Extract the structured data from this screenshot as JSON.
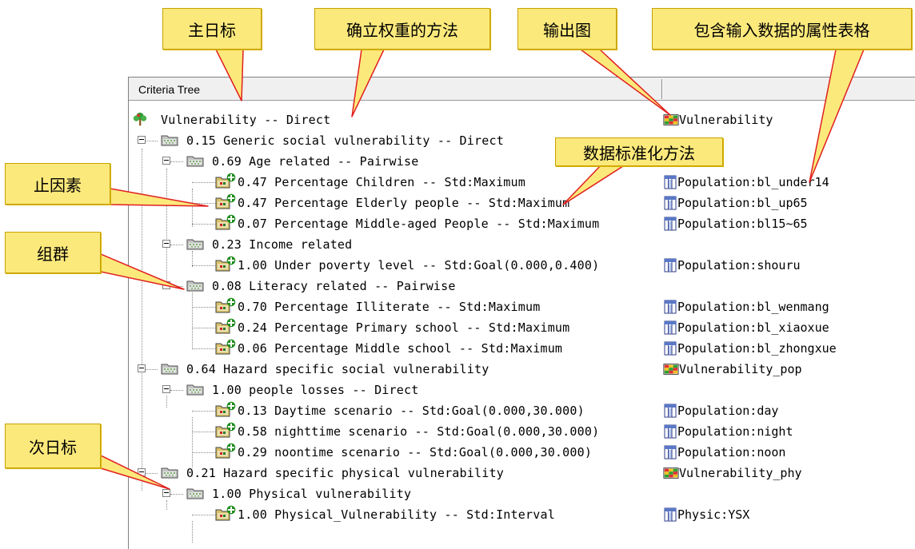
{
  "header": {
    "title": "Criteria Tree"
  },
  "callouts": {
    "main_goal": "主日标",
    "weight_method": "确立权重的方法",
    "output_map": "输出图",
    "attr_table": "包含输入数据的属性表格",
    "std_method": "数据标准化方法",
    "positive_factor": "止因素",
    "group": "组群",
    "sub_goal": "次日标"
  },
  "tree": {
    "root": {
      "label": "Vulnerability -- Direct",
      "right": "Vulnerability"
    },
    "generic": {
      "label": "0.15 Generic social vulnerability -- Direct"
    },
    "age": {
      "label": "0.69 Age related -- Pairwise"
    },
    "age_children": {
      "label": "0.47 Percentage Children -- Std:Maximum",
      "right": "Population:bl_under14"
    },
    "age_elderly": {
      "label": "0.47 Percentage Elderly people -- Std:Maximum",
      "right": "Population:bl_up65"
    },
    "age_middle": {
      "label": "0.07 Percentage Middle-aged People -- Std:Maximum",
      "right": "Population:bl15~65"
    },
    "income": {
      "label": "0.23 Income related"
    },
    "income_poverty": {
      "label": "1.00 Under poverty level -- Std:Goal(0.000,0.400)",
      "right": "Population:shouru"
    },
    "literacy": {
      "label": "0.08 Literacy related -- Pairwise"
    },
    "lit_illiterate": {
      "label": "0.70 Percentage Illiterate -- Std:Maximum",
      "right": "Population:bl_wenmang"
    },
    "lit_primary": {
      "label": "0.24 Percentage Primary school -- Std:Maximum",
      "right": "Population:bl_xiaoxue"
    },
    "lit_middle": {
      "label": "0.06 Percentage Middle school -- Std:Maximum",
      "right": "Population:bl_zhongxue"
    },
    "hazard_social": {
      "label": "0.64 Hazard specific social vulnerability",
      "right": "Vulnerability_pop"
    },
    "people_losses": {
      "label": "1.00 people losses -- Direct"
    },
    "pl_day": {
      "label": "0.13 Daytime scenario -- Std:Goal(0.000,30.000)",
      "right": "Population:day"
    },
    "pl_night": {
      "label": "0.58 nighttime scenario -- Std:Goal(0.000,30.000)",
      "right": "Population:night"
    },
    "pl_noon": {
      "label": "0.29 noontime scenario -- Std:Goal(0.000,30.000)",
      "right": "Population:noon"
    },
    "hazard_physical": {
      "label": "0.21 Hazard specific physical vulnerability",
      "right": "Vulnerability_phy"
    },
    "physical": {
      "label": "1.00 Physical vulnerability"
    },
    "physical_item": {
      "label": "1.00 Physical_Vulnerability -- Std:Interval",
      "right": "Physic:YSX"
    }
  },
  "colors": {
    "callout_fill": "#fbe97c",
    "callout_border": "#c9a100",
    "pointer_line": "#e02020"
  },
  "icons": {
    "root": "tree-icon",
    "group": "folder-icon",
    "leaf": "criterion-plus-icon",
    "table": "table-icon",
    "map": "map-grid-icon"
  }
}
